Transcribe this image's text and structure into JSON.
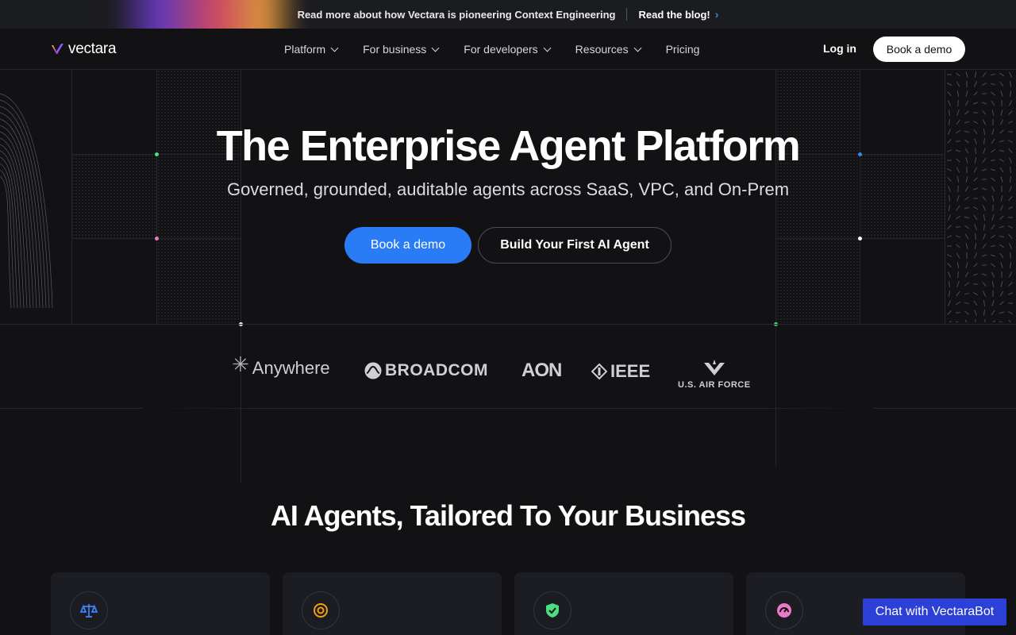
{
  "announcement": {
    "message": "Read more about how Vectara is pioneering Context Engineering",
    "link_label": "Read the blog!",
    "chevron_icon": "chevron-right-icon"
  },
  "nav": {
    "logo_text": "vectara",
    "items": [
      {
        "label": "Platform",
        "has_dropdown": true
      },
      {
        "label": "For business",
        "has_dropdown": true
      },
      {
        "label": "For developers",
        "has_dropdown": true
      },
      {
        "label": "Resources",
        "has_dropdown": true
      },
      {
        "label": "Pricing",
        "has_dropdown": false
      }
    ],
    "login_label": "Log in",
    "demo_label": "Book a demo"
  },
  "hero": {
    "title": "The Enterprise Agent Platform",
    "subtitle": "Governed, grounded, auditable agents across SaaS, VPC, and On-Prem",
    "primary_cta": "Book a demo",
    "secondary_cta": "Build Your First AI Agent"
  },
  "customer_logos": [
    {
      "name": "Anywhere",
      "icon": "asterisk-icon"
    },
    {
      "name": "BROADCOM",
      "icon": "broadcom-icon"
    },
    {
      "name": "AON",
      "icon": ""
    },
    {
      "name": "IEEE",
      "icon": "ieee-diamond-icon"
    },
    {
      "name": "U.S. AIR FORCE",
      "icon": "air-force-wings-icon"
    }
  ],
  "section": {
    "title": "AI Agents, Tailored To Your Business"
  },
  "cards": [
    {
      "icon": "scales-icon",
      "color": "#3b82f6"
    },
    {
      "icon": "target-icon",
      "color": "#f59e0b"
    },
    {
      "icon": "shield-check-icon",
      "color": "#4ade80"
    },
    {
      "icon": "gauge-icon",
      "color": "#e879c9"
    }
  ],
  "chat_widget": {
    "label": "Chat with VectaraBot"
  },
  "colors": {
    "background": "#121215",
    "primary": "#2a7cf6",
    "chat": "#2c3fd6"
  }
}
